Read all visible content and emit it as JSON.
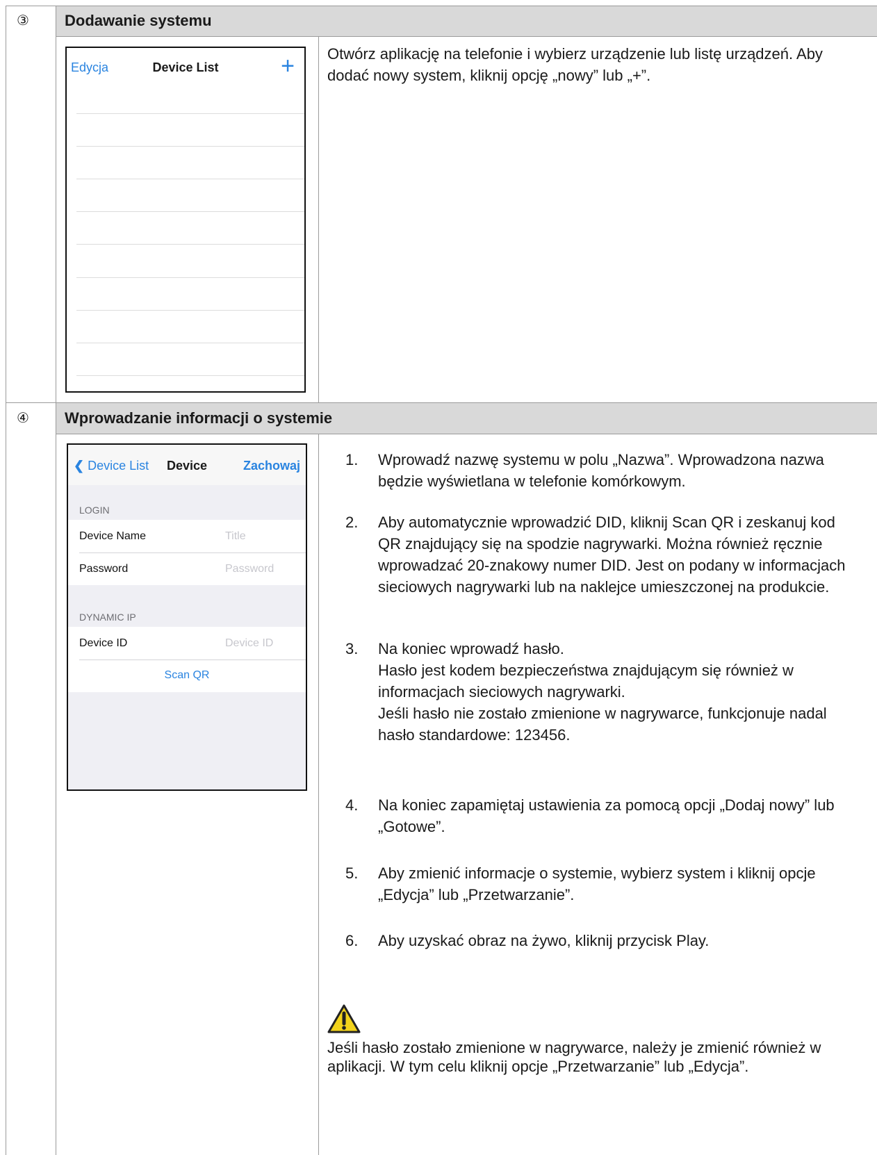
{
  "section3": {
    "number": "③",
    "title": "Dodawanie systemu",
    "phone": {
      "edit": "Edycja",
      "title": "Device List",
      "add": "+"
    },
    "description": "Otwórz aplikację na telefonie i wybierz urządzenie lub listę urządzeń. Aby dodać nowy system, kliknij opcję „nowy” lub „+”."
  },
  "section4": {
    "number": "④",
    "title": "Wprowadzanie informacji o systemie",
    "phone": {
      "back": "Device List",
      "title": "Device",
      "save": "Zachowaj",
      "login_label": "LOGIN",
      "device_name": "Device Name",
      "device_name_placeholder": "Title",
      "password": "Password",
      "password_placeholder": "Password",
      "dynamic_ip_label": "DYNAMIC IP",
      "device_id": "Device ID",
      "device_id_placeholder": "Device ID",
      "scan_qr": "Scan QR"
    },
    "steps": [
      {
        "n": "1.",
        "text": "Wprowadź nazwę systemu w polu „Nazwa”. Wprowadzona nazwa będzie wyświetlana w telefonie komórkowym."
      },
      {
        "n": "2.",
        "text": "Aby automatycznie wprowadzić DID, kliknij Scan QR i zeskanuj kod QR znajdujący się na spodzie nagrywarki. Można również ręcznie wprowadzać 20-znakowy numer DID. Jest on podany w informacjach sieciowych nagrywarki lub na naklejce umieszczonej na produkcie."
      },
      {
        "n": "3.",
        "text": "Na koniec wprowadź hasło.",
        "line2": "Hasło jest kodem bezpieczeństwa znajdującym się również w informacjach sieciowych nagrywarki.",
        "line3": "Jeśli hasło nie zostało zmienione w nagrywarce, funkcjonuje nadal hasło standardowe: 123456."
      },
      {
        "n": "4.",
        "text": "Na koniec zapamiętaj ustawienia za pomocą opcji „Dodaj nowy” lub „Gotowe”."
      },
      {
        "n": "5.",
        "text": "Aby zmienić informacje o systemie, wybierz system i kliknij opcje „Edycja” lub „Przetwarzanie”."
      },
      {
        "n": "6.",
        "text": "Aby uzyskać obraz na żywo, kliknij przycisk Play."
      }
    ],
    "warning": "Jeśli hasło zostało zmienione w nagrywarce, należy je zmienić również w aplikacji. W tym celu kliknij opcje „Przetwarzanie” lub „Edycja”."
  }
}
